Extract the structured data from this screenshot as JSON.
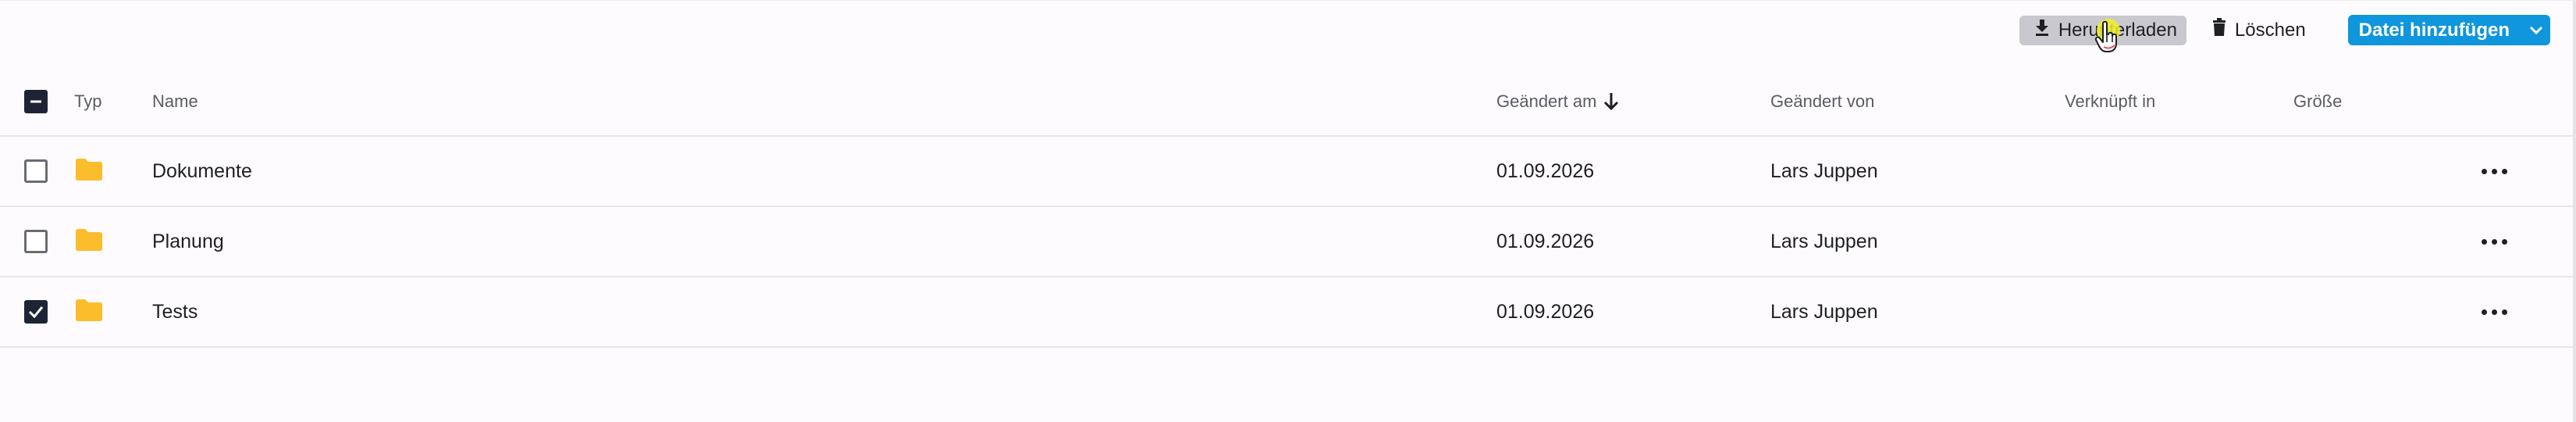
{
  "toolbar": {
    "download_label": "Herunterladen",
    "delete_label": "Löschen",
    "add_label": "Datei hinzufügen"
  },
  "table": {
    "headers": {
      "type": "Typ",
      "name": "Name",
      "modified_at": "Geändert am",
      "modified_by": "Geändert von",
      "linked_in": "Verknüpft in",
      "size": "Größe"
    },
    "sort": {
      "column": "modified_at",
      "direction": "descending"
    },
    "select_all_state": "indeterminate",
    "rows": [
      {
        "type": "folder-icon",
        "name": "Dokumente",
        "modified_at": "01.09.2026",
        "modified_by": "Lars Juppen",
        "linked_in": "",
        "size": "",
        "selected": false
      },
      {
        "type": "folder-icon",
        "name": "Planung",
        "modified_at": "01.09.2026",
        "modified_by": "Lars Juppen",
        "linked_in": "",
        "size": "",
        "selected": false
      },
      {
        "type": "folder-icon",
        "name": "Tests",
        "modified_at": "01.09.2026",
        "modified_by": "Lars Juppen",
        "linked_in": "",
        "size": "",
        "selected": true
      }
    ]
  },
  "colors": {
    "primary": "#0f96dd",
    "folder": "#fbbd2c",
    "checkbox_checked": "#1c2435",
    "download_button_bg": "#c9c8cf"
  }
}
